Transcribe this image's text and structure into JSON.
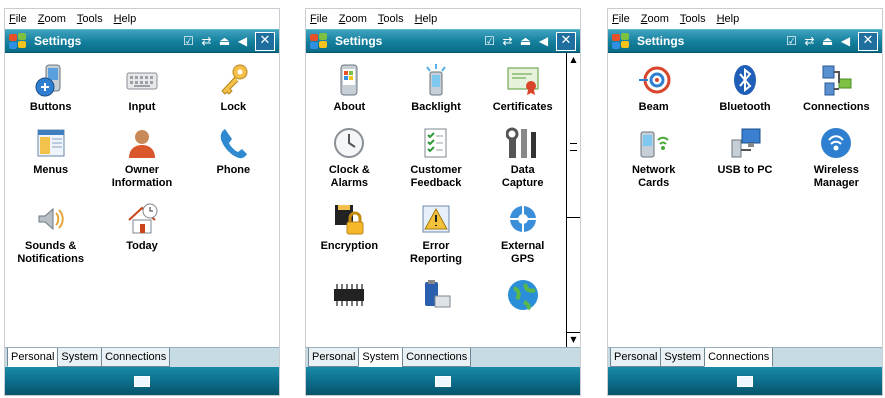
{
  "menu": [
    {
      "pre": "",
      "u": "F",
      "post": "ile"
    },
    {
      "pre": "",
      "u": "Z",
      "post": "oom"
    },
    {
      "pre": "",
      "u": "T",
      "post": "ools"
    },
    {
      "pre": "",
      "u": "H",
      "post": "elp"
    }
  ],
  "screens": [
    {
      "title": "Settings",
      "items": [
        {
          "label": "Buttons",
          "icon": "buttons-icon"
        },
        {
          "label": "Input",
          "icon": "keyboard-icon"
        },
        {
          "label": "Lock",
          "icon": "key-icon"
        },
        {
          "label": "Menus",
          "icon": "menus-icon"
        },
        {
          "label": "Owner\nInformation",
          "icon": "owner-icon"
        },
        {
          "label": "Phone",
          "icon": "phone-icon"
        },
        {
          "label": "Sounds &\nNotifications",
          "icon": "sounds-icon"
        },
        {
          "label": "Today",
          "icon": "today-icon"
        }
      ],
      "tabs": [
        "Personal",
        "System",
        "Connections"
      ],
      "active_tab": 0
    },
    {
      "title": "Settings",
      "items": [
        {
          "label": "About",
          "icon": "about-icon"
        },
        {
          "label": "Backlight",
          "icon": "backlight-icon"
        },
        {
          "label": "Certificates",
          "icon": "certificate-icon"
        },
        {
          "label": "Clock &\nAlarms",
          "icon": "clock-icon"
        },
        {
          "label": "Customer\nFeedback",
          "icon": "feedback-icon"
        },
        {
          "label": "Data\nCapture",
          "icon": "tools-icon"
        },
        {
          "label": "Encryption",
          "icon": "encryption-icon"
        },
        {
          "label": "Error\nReporting",
          "icon": "error-icon"
        },
        {
          "label": "External\nGPS",
          "icon": "gps-icon"
        },
        {
          "label": "",
          "icon": "memory-icon"
        },
        {
          "label": "",
          "icon": "power-icon"
        },
        {
          "label": "",
          "icon": "globe-icon"
        }
      ],
      "tabs": [
        "Personal",
        "System",
        "Connections"
      ],
      "active_tab": 1
    },
    {
      "title": "Settings",
      "items": [
        {
          "label": "Beam",
          "icon": "beam-icon"
        },
        {
          "label": "Bluetooth",
          "icon": "bluetooth-icon"
        },
        {
          "label": "Connections",
          "icon": "connections-icon"
        },
        {
          "label": "Network\nCards",
          "icon": "network-icon"
        },
        {
          "label": "USB to PC",
          "icon": "usb-icon"
        },
        {
          "label": "Wireless\nManager",
          "icon": "wireless-icon"
        }
      ],
      "tabs": [
        "Personal",
        "System",
        "Connections"
      ],
      "active_tab": 2
    }
  ],
  "colors": {
    "titlebar": "#137f9c",
    "tabbar": "#c7dbe4",
    "bottombar": "#0d6f8c"
  }
}
